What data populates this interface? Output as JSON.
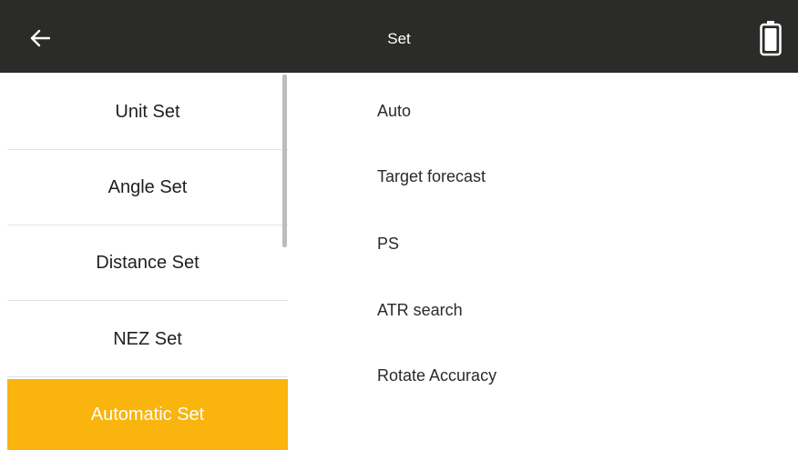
{
  "header": {
    "title": "Set",
    "back_icon": "arrow-left-icon",
    "battery_icon": "battery-icon"
  },
  "sidebar": {
    "items": [
      {
        "label": "Unit Set"
      },
      {
        "label": "Angle Set"
      },
      {
        "label": "Distance Set"
      },
      {
        "label": "NEZ Set"
      },
      {
        "label": "Automatic Set",
        "active": true
      }
    ]
  },
  "main": {
    "options": [
      {
        "label": "Auto"
      },
      {
        "label": "Target forecast"
      },
      {
        "label": "PS"
      },
      {
        "label": "ATR search"
      },
      {
        "label": "Rotate Accuracy"
      }
    ]
  },
  "colors": {
    "header_bg": "#2b2b29",
    "accent": "#f9b40e"
  }
}
